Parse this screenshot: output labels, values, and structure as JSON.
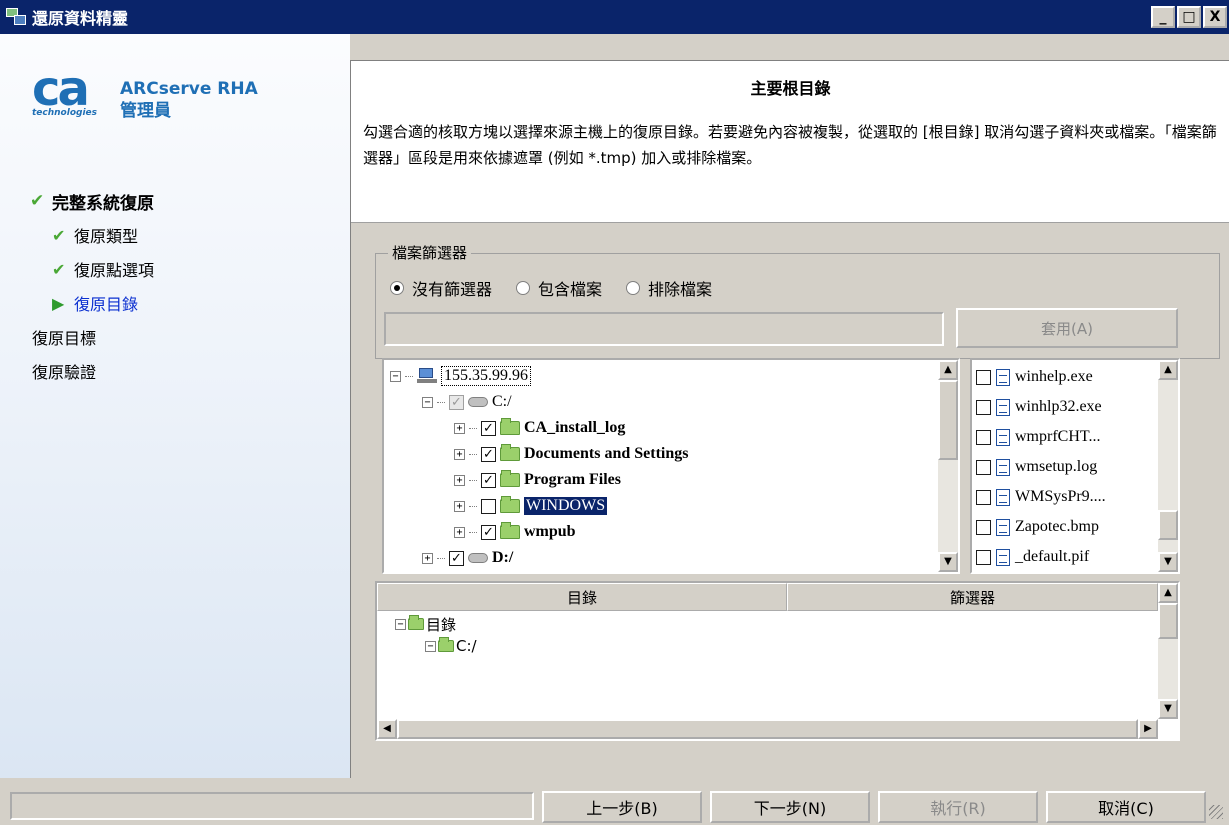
{
  "window": {
    "title": "還原資料精靈",
    "min": "_",
    "max": "□",
    "close": "X"
  },
  "sidebar": {
    "logo_text": "ca",
    "logo_sub": "technologies",
    "product_line1": "ARCserve RHA",
    "product_line2": "管理員",
    "steps": [
      {
        "label": "完整系統復原",
        "state": "done"
      },
      {
        "label": "復原類型",
        "state": "done"
      },
      {
        "label": "復原點選項",
        "state": "done"
      },
      {
        "label": "復原目錄",
        "state": "current"
      },
      {
        "label": "復原目標",
        "state": "pending"
      },
      {
        "label": "復原驗證",
        "state": "pending"
      }
    ]
  },
  "header": {
    "title": "主要根目錄",
    "description": "勾選合適的核取方塊以選擇來源主機上的復原目錄。若要避免內容被複製，從選取的 [根目錄] 取消勾選子資料夾或檔案。「檔案篩選器」區段是用來依據遮罩 (例如 *.tmp) 加入或排除檔案。"
  },
  "filter": {
    "legend": "檔案篩選器",
    "options": [
      "沒有篩選器",
      "包含檔案",
      "排除檔案"
    ],
    "selected": "沒有篩選器",
    "input_value": "",
    "apply_label": "套用(A)"
  },
  "tree": {
    "host": "155.35.99.96",
    "drive_c": "C:/",
    "folders": [
      {
        "label": "CA_install_log",
        "checked": true
      },
      {
        "label": "Documents and Settings",
        "checked": true
      },
      {
        "label": "Program Files",
        "checked": true
      },
      {
        "label": "WINDOWS",
        "checked": false
      },
      {
        "label": "wmpub",
        "checked": true
      }
    ],
    "drive_d": "D:/"
  },
  "files": [
    "winhelp.exe",
    "winhlp32.exe",
    "wmprfCHT...",
    "wmsetup.log",
    "WMSysPr9....",
    "Zapotec.bmp",
    "_default.pif"
  ],
  "dir_list": {
    "col_directory": "目錄",
    "col_filter": "篩選器",
    "root": "目錄",
    "child": "C:/"
  },
  "nav": {
    "back": "上一步(B)",
    "next": "下一步(N)",
    "run": "執行(R)",
    "cancel": "取消(C)",
    "status": ""
  }
}
